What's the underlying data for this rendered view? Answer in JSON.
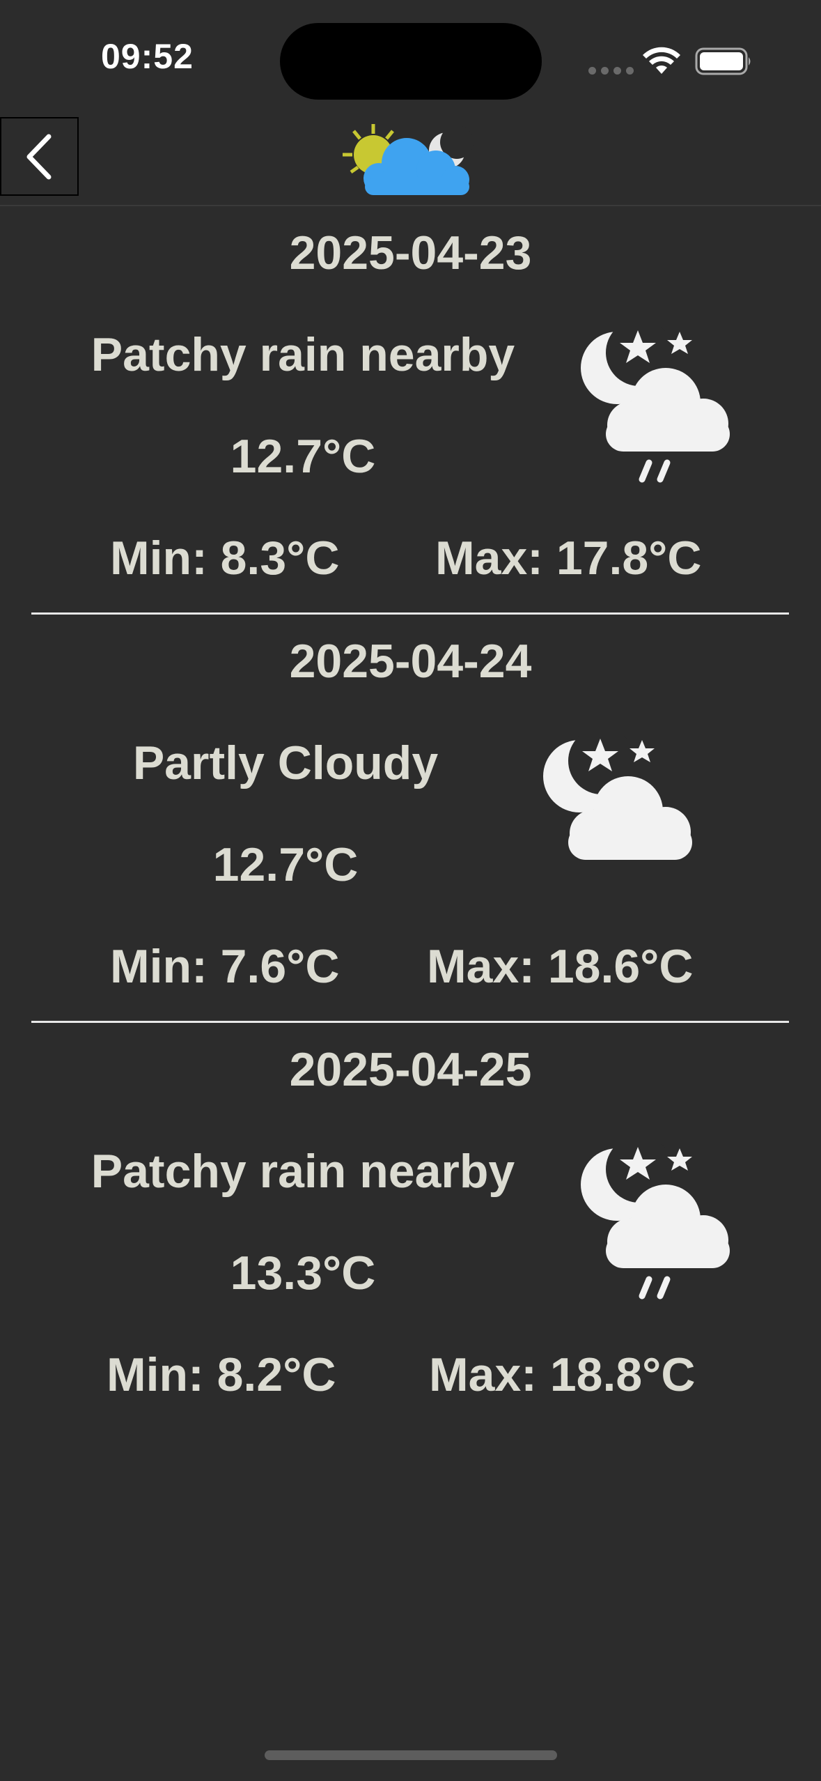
{
  "status_bar": {
    "time": "09:52"
  },
  "nav": {
    "back_icon": "chevron-left-icon",
    "logo_icon": "sun-cloud-moon-icon"
  },
  "days": [
    {
      "date": "2025-04-23",
      "condition": "Patchy rain nearby",
      "temp": "12.7°C",
      "min": "Min: 8.3°C",
      "max": "Max: 17.8°C",
      "icon": "night-rain-icon"
    },
    {
      "date": "2025-04-24",
      "condition": "Partly Cloudy",
      "temp": "12.7°C",
      "min": "Min: 7.6°C",
      "max": "Max: 18.6°C",
      "icon": "night-partly-cloudy-icon"
    },
    {
      "date": "2025-04-25",
      "condition": "Patchy rain nearby",
      "temp": "13.3°C",
      "min": "Min: 8.2°C",
      "max": "Max: 18.8°C",
      "icon": "night-rain-icon"
    }
  ],
  "colors": {
    "background": "#2c2c2c",
    "text": "#dcdcd2",
    "logo_cloud": "#3fa3f0",
    "logo_sun": "#c8c832"
  }
}
